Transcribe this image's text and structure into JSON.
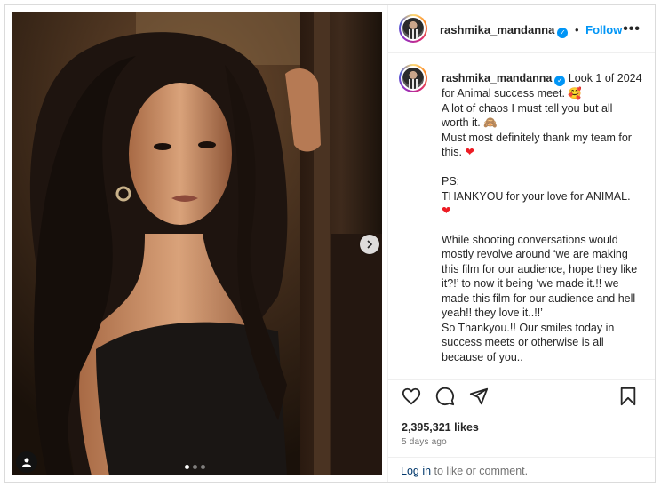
{
  "post": {
    "username": "rashmika_mandanna",
    "verified_mark": "✓",
    "separator": "•",
    "follow_label": "Follow",
    "more_label": "•••",
    "caption_lines": [
      "Look 1 of 2024 for Animal success meet. 🥰",
      "A lot of chaos I must tell you but all worth it. 🙈",
      "Must most definitely thank my team for this. ",
      "",
      "PS:",
      "THANKYOU for your love for ANIMAL.",
      "",
      "While shooting conversations would mostly revolve around ‘we are making this film for our audience, hope they like it?!’ to now it being ‘we made it.!! we made this film for our audience and hell yeah!! they love it..!!’",
      "So Thankyou.!! Our smiles today in success meets or otherwise is all because of you.."
    ],
    "heart_glyph": "❤",
    "likes": "2,395,321 likes",
    "time_ago": "5 days ago",
    "login_link": "Log in",
    "login_suffix": " to like or comment."
  },
  "media": {
    "carousel_dots": 3,
    "active_dot": 0,
    "next_icon": "chevron-right-icon",
    "tag_icon": "user-tag-icon"
  },
  "icons": {
    "like": "heart-outline-icon",
    "comment": "comment-bubble-icon",
    "share": "paper-plane-icon",
    "save": "bookmark-icon"
  },
  "colors": {
    "accent": "#0095f6",
    "heart": "#ed1c24",
    "muted": "#737373",
    "link": "#00376b"
  }
}
